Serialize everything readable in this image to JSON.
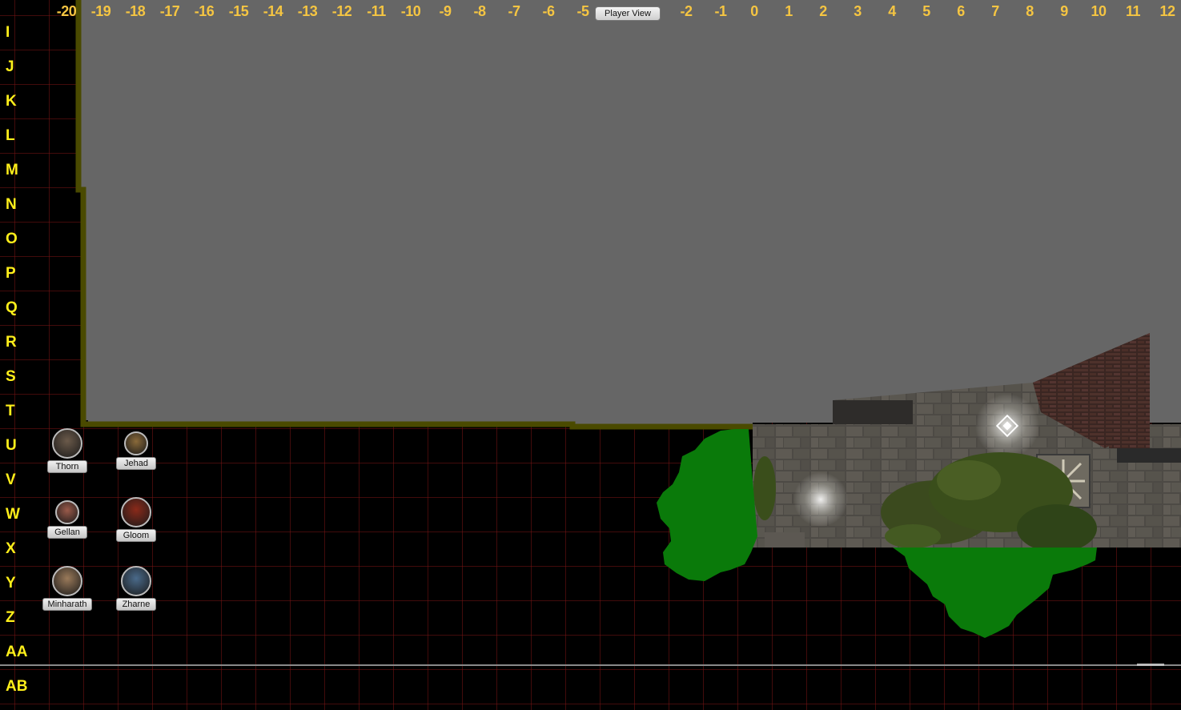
{
  "player_view_label": "Player View",
  "columns": [
    "-20",
    "-19",
    "-18",
    "-17",
    "-16",
    "-15",
    "-14",
    "-13",
    "-12",
    "-11",
    "-10",
    "-9",
    "-8",
    "-7",
    "-6",
    "-5",
    "-2",
    "-1",
    "0",
    "1",
    "2",
    "3",
    "4",
    "5",
    "6",
    "7",
    "8",
    "9",
    "10",
    "11",
    "12"
  ],
  "rows": [
    "I",
    "J",
    "K",
    "L",
    "M",
    "N",
    "O",
    "P",
    "Q",
    "R",
    "S",
    "T",
    "U",
    "V",
    "W",
    "X",
    "Y",
    "Z",
    "AA",
    "AB"
  ],
  "tokens": [
    {
      "name": "Thorn",
      "color": "#6b5a4a"
    },
    {
      "name": "Jehad",
      "color": "#8a6a3a"
    },
    {
      "name": "Gellan",
      "color": "#9a5a4a"
    },
    {
      "name": "Gloom",
      "color": "#8a2a1a"
    },
    {
      "name": "Minharath",
      "color": "#9a7a5a"
    },
    {
      "name": "Zharne",
      "color": "#4a6a8a"
    }
  ],
  "colors": {
    "fog": "#666666",
    "fog_border": "#4a4a00",
    "label_yellow": "#ffef1a",
    "forest": "#0a7a0a"
  }
}
